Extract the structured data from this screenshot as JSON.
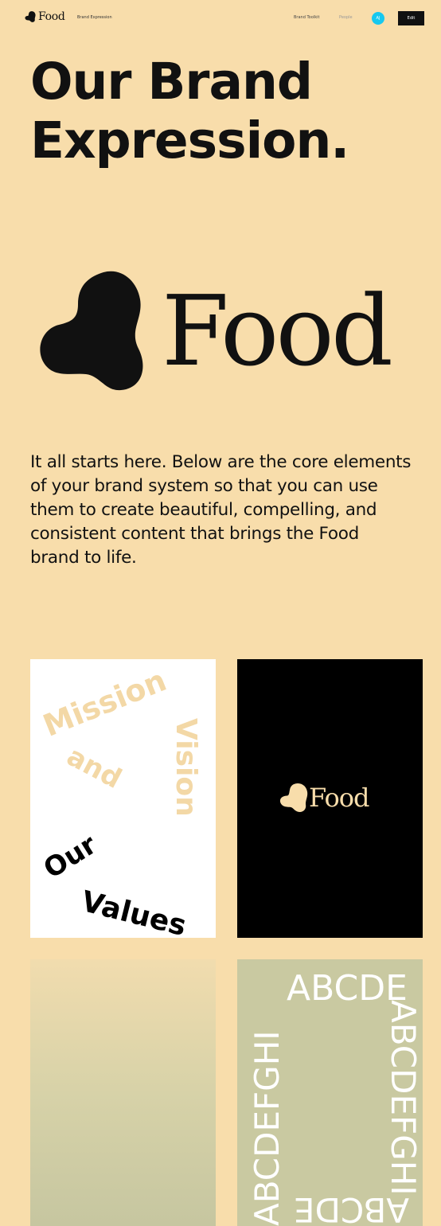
{
  "nav": {
    "logo_text": "Food",
    "section": "Brand Expression",
    "links": [
      "Brand Toolkit",
      "People"
    ],
    "avatar_initials": "AJ",
    "edit_label": "Edit",
    "avatar_color": "#17c8ef"
  },
  "hero": {
    "title_line1": "Our Brand",
    "title_line2": "Expression.",
    "logo_word": "Food"
  },
  "intro": {
    "text": "It all starts here. Below are the core elements of your brand system so that you can use them to create beautiful, compelling, and consistent content that brings the Food brand to life."
  },
  "cards": {
    "values": {
      "words": [
        "Mission",
        "and",
        "Vision",
        "Our",
        "Values"
      ]
    },
    "logo": {
      "word": "Food"
    },
    "typography": {
      "top": "ABCDE",
      "left": "ABCDEFGHI",
      "right": "ABCDEFGHI",
      "bottom": "ABCDE"
    }
  },
  "colors": {
    "background": "#f8ddab",
    "ink": "#111111",
    "sage": "#c9c9a1"
  },
  "icons": {
    "logo_mark": "blob-logo-icon"
  }
}
